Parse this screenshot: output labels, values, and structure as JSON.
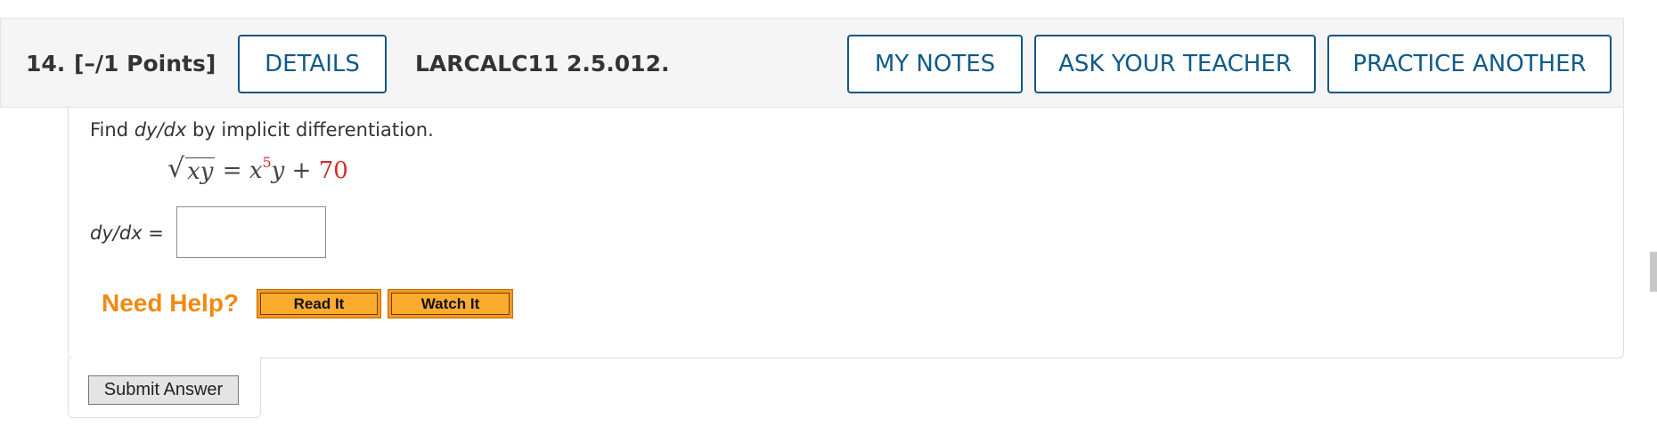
{
  "question": {
    "number": "14.",
    "points": "[–/1 Points]",
    "code": "LARCALC11 2.5.012."
  },
  "header_buttons": {
    "details": "DETAILS",
    "my_notes": "MY NOTES",
    "ask_teacher": "ASK YOUR TEACHER",
    "practice_another": "PRACTICE ANOTHER"
  },
  "prompt": {
    "before": "Find ",
    "derivative": "dy/dx",
    "after": " by implicit differentiation."
  },
  "equation": {
    "sqrt_sign": "√",
    "radicand": "xy",
    "equals": " = ",
    "base": "x",
    "exponent": "5",
    "y": "y",
    "plus": " + ",
    "constant": "70"
  },
  "answer": {
    "label_var": "dy/dx",
    "label_eq": " =",
    "value": "",
    "placeholder": ""
  },
  "help": {
    "label": "Need Help?",
    "read_it": "Read It",
    "watch_it": "Watch It"
  },
  "submit": {
    "label": "Submit Answer"
  },
  "colors": {
    "header_bg": "#f5f5f5",
    "button_border": "#0e5588",
    "button_text": "#0e5a8a",
    "help_orange": "#f08a13",
    "help_button": "#fbab2e",
    "constant_red": "#d42a2a"
  }
}
